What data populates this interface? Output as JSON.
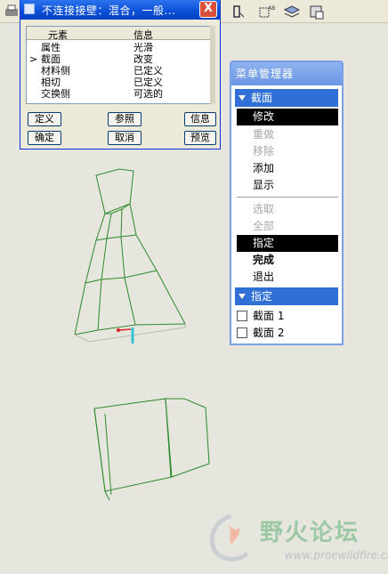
{
  "dialog": {
    "title": "不连接接壁：混合，一般...",
    "close_label": "X",
    "list": {
      "columns": [
        "元素",
        "信息"
      ],
      "rows": [
        {
          "element": "属性",
          "info": "光滑",
          "marker": ""
        },
        {
          "element": "截面",
          "info": "改变",
          "marker": ">"
        },
        {
          "element": "材料侧",
          "info": "已定义",
          "marker": ""
        },
        {
          "element": "相切",
          "info": "已定义",
          "marker": ""
        },
        {
          "element": "交换侧",
          "info": "可选的",
          "marker": ""
        }
      ]
    },
    "buttons": {
      "define": "定义",
      "ref": "参照",
      "info": "信息",
      "ok": "确定",
      "cancel": "取消",
      "preview": "预览"
    }
  },
  "menu": {
    "title": "菜单管理器",
    "section1": "截面",
    "items1": [
      {
        "label": "修改",
        "state": "selected"
      },
      {
        "label": "重做",
        "state": "disabled"
      },
      {
        "label": "移除",
        "state": "disabled"
      },
      {
        "label": "添加",
        "state": "normal"
      },
      {
        "label": "显示",
        "state": "normal"
      }
    ],
    "items2": [
      {
        "label": "选取",
        "state": "disabled"
      },
      {
        "label": "全部",
        "state": "disabled"
      },
      {
        "label": "指定",
        "state": "selected"
      },
      {
        "label": "完成",
        "state": "bold"
      },
      {
        "label": "退出",
        "state": "normal"
      }
    ],
    "section2": "指定",
    "checkboxes": [
      {
        "label": "截面 1",
        "checked": false
      },
      {
        "label": "截面 2",
        "checked": false
      }
    ]
  },
  "watermark": {
    "site_name": "野火论坛",
    "url": "www.proewildfire.cn"
  },
  "colors": {
    "background": "#e7e6de",
    "wireframe": "#2b8a2b",
    "title_bar": "#0a4fd6",
    "menu_section": "#2f6fd6"
  }
}
